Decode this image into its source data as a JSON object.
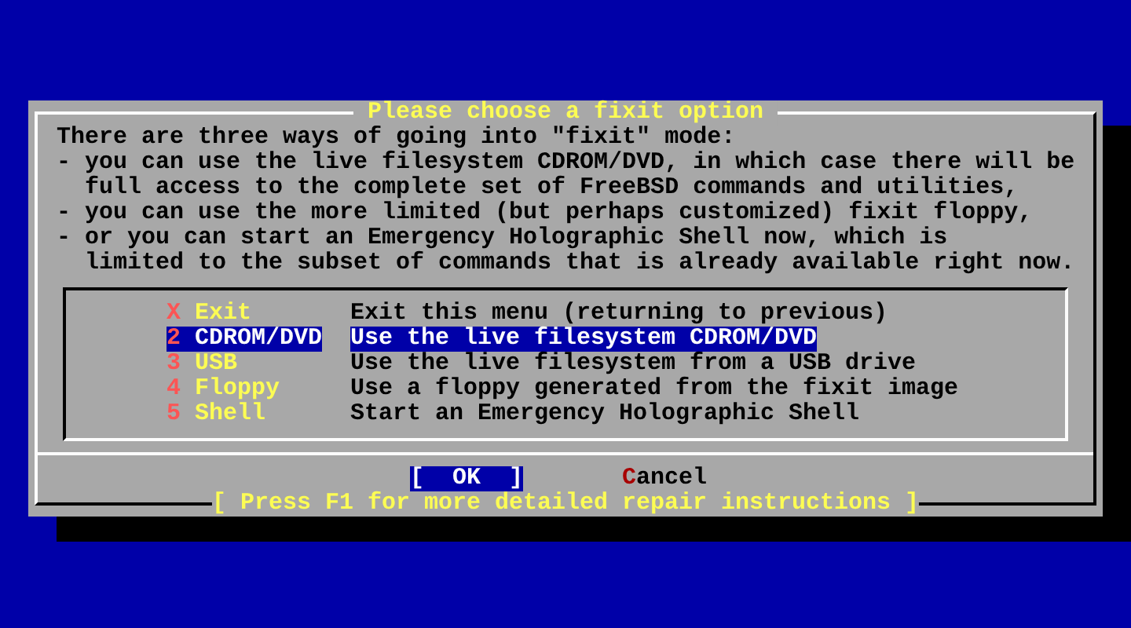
{
  "dialog": {
    "title": "Please choose a fixit option",
    "message_lines": [
      "There are three ways of going into \"fixit\" mode:",
      "- you can use the live filesystem CDROM/DVD, in which case there will be",
      "  full access to the complete set of FreeBSD commands and utilities,",
      "- you can use the more limited (but perhaps customized) fixit floppy,",
      "- or you can start an Emergency Holographic Shell now, which is",
      "  limited to the subset of commands that is already available right now."
    ],
    "menu": [
      {
        "key": "X",
        "label": "Exit",
        "description": "Exit this menu (returning to previous)",
        "selected": false
      },
      {
        "key": "2",
        "label": "CDROM/DVD",
        "description": "Use the live filesystem CDROM/DVD",
        "selected": true
      },
      {
        "key": "3",
        "label": "USB",
        "description": "Use the live filesystem from a USB drive",
        "selected": false
      },
      {
        "key": "4",
        "label": "Floppy",
        "description": "Use a floppy generated from the fixit image",
        "selected": false
      },
      {
        "key": "5",
        "label": "Shell",
        "description": "Start an Emergency Holographic Shell",
        "selected": false
      }
    ],
    "buttons": [
      {
        "label": "[  OK  ]",
        "selected": true
      },
      {
        "hotkey": "C",
        "label": "ancel",
        "selected": false
      }
    ],
    "hint": "[ Press F1 for more detailed repair instructions ]"
  }
}
